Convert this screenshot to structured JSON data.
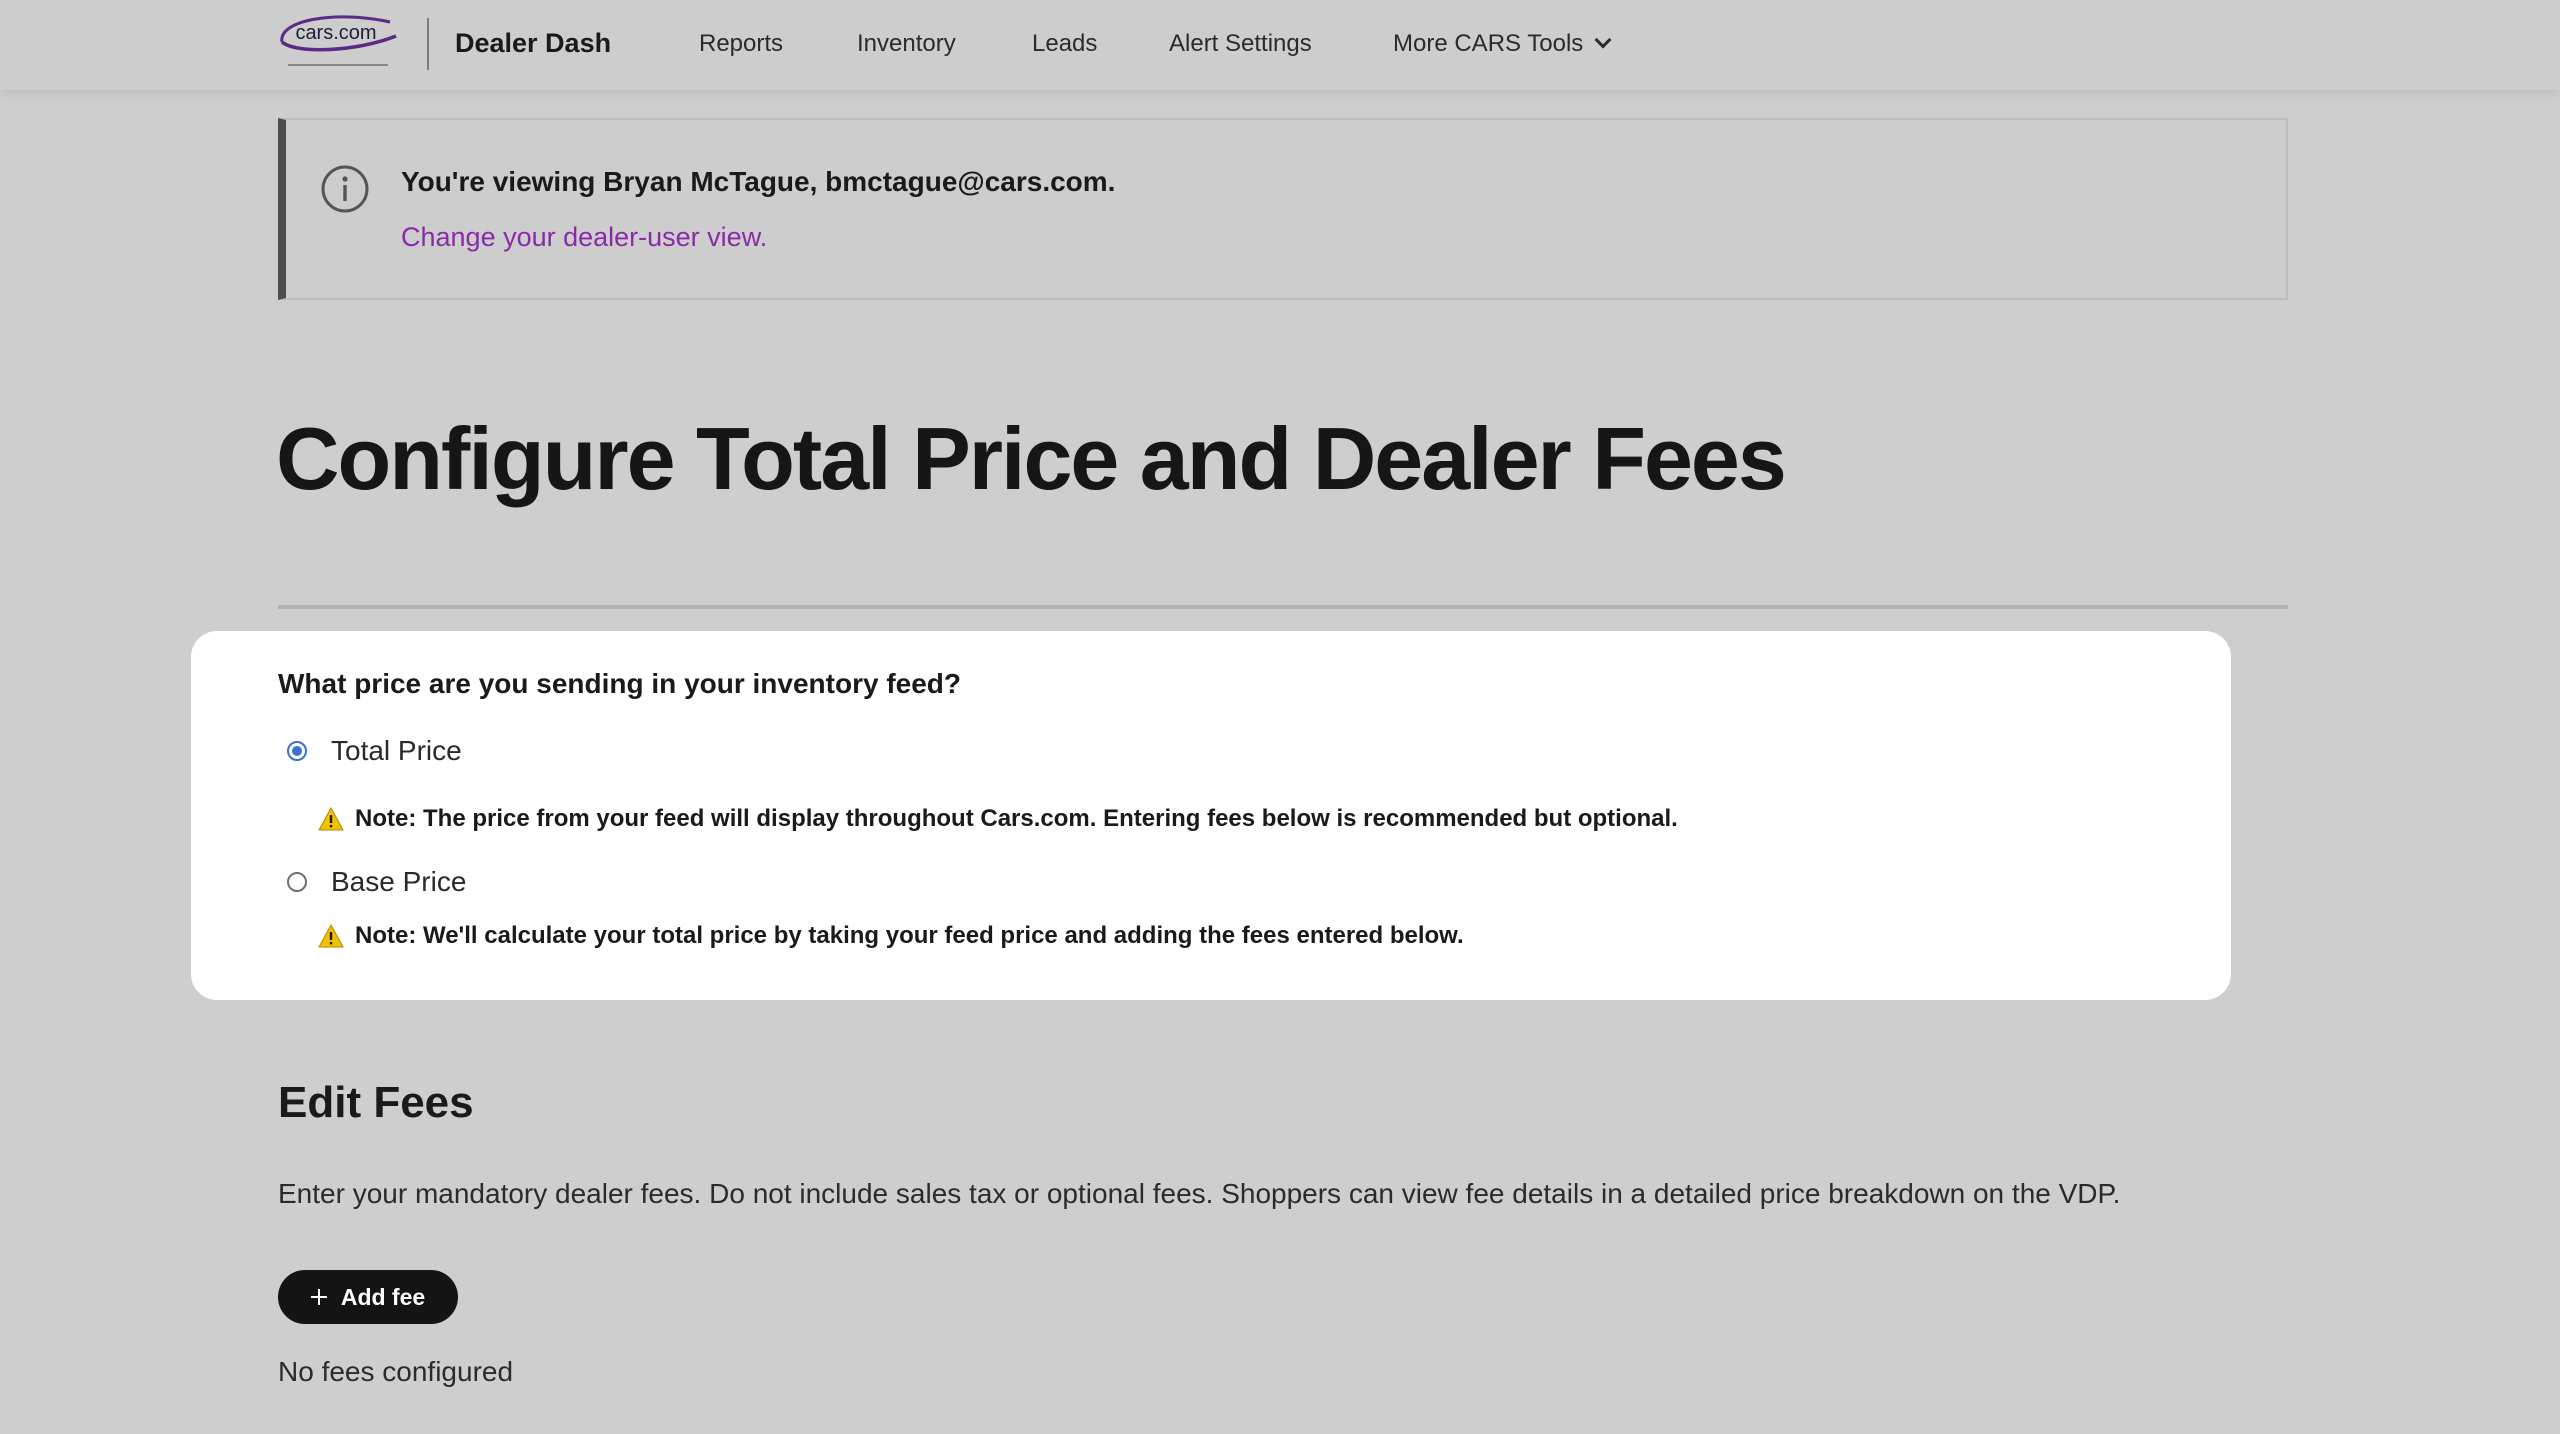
{
  "header": {
    "logo": {
      "icon": "cars-com-logo-icon",
      "text": "cars.com"
    },
    "brand": "Dealer Dash",
    "nav": [
      {
        "label": "Reports"
      },
      {
        "label": "Inventory"
      },
      {
        "label": "Leads"
      },
      {
        "label": "Alert Settings"
      },
      {
        "label": "More CARS Tools",
        "icon": "chevron-down-icon"
      }
    ]
  },
  "notice": {
    "icon": "info-icon",
    "message": "You're viewing Bryan McTague, bmctague@cars.com.",
    "link": "Change your dealer-user view."
  },
  "page": {
    "title": "Configure Total Price and Dealer Fees"
  },
  "price_card": {
    "question": "What price are you sending in your inventory feed?",
    "options": [
      {
        "label": "Total Price",
        "selected": true,
        "note": "Note: The price from your feed will display throughout Cars.com. Entering fees below is recommended but optional."
      },
      {
        "label": "Base Price",
        "selected": false,
        "note": "Note: We'll calculate your total price by taking your feed price and adding the fees entered below."
      }
    ],
    "note_icon": "warning-icon"
  },
  "edit_fees": {
    "title": "Edit Fees",
    "description": "Enter your mandatory dealer fees. Do not include sales tax or optional fees. Shoppers can view fee details in a detailed price breakdown on the VDP.",
    "add_button": "Add fee",
    "add_icon": "plus-icon",
    "empty_state": "No fees configured"
  },
  "colors": {
    "background": "#cecece",
    "card": "#ffffff",
    "link": "#8a2aa8",
    "radio_selected": "#3c6ed6",
    "warning": "#f2c200",
    "button": "#141414"
  }
}
